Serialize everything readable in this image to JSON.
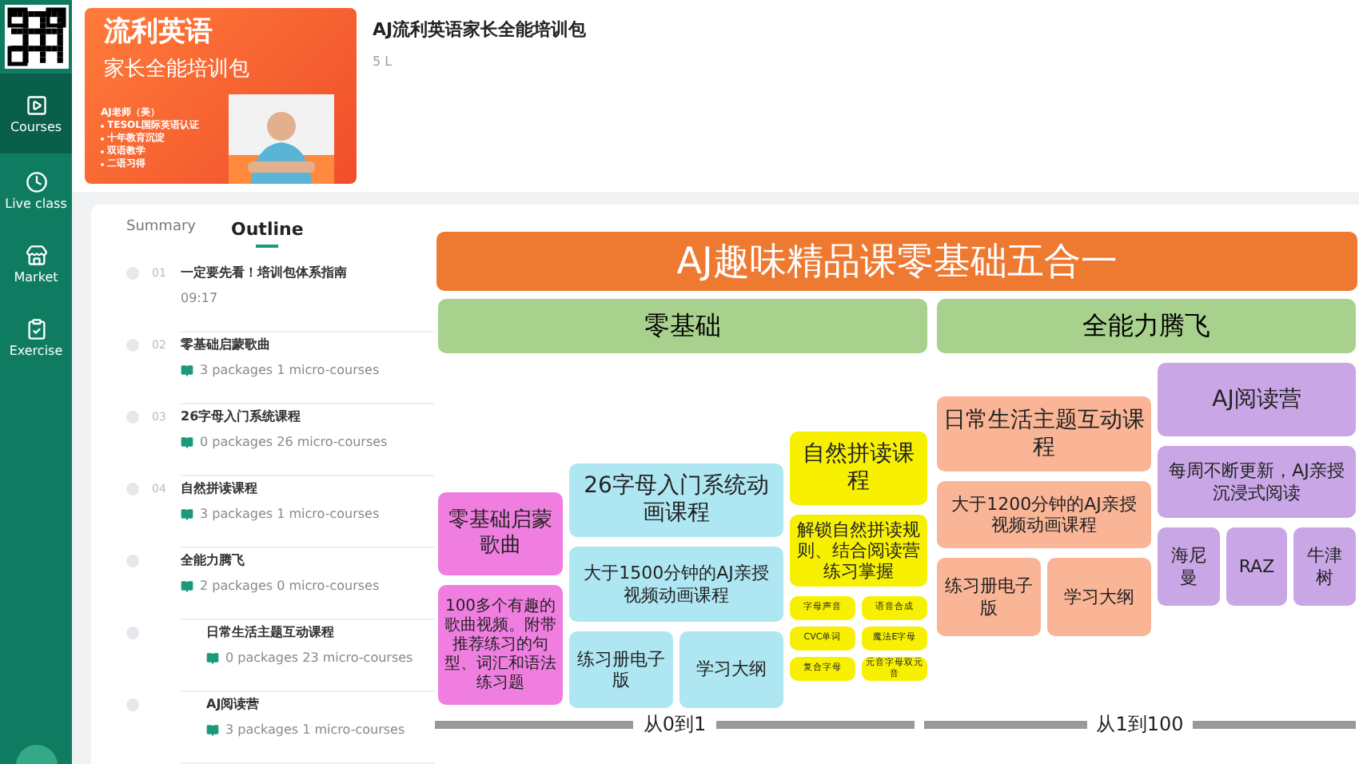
{
  "sidebar": {
    "items": [
      {
        "label": "Courses",
        "kind": "courses",
        "selected": true
      },
      {
        "label": "Live class",
        "kind": "live",
        "selected": false
      },
      {
        "label": "Market",
        "kind": "market",
        "selected": false
      },
      {
        "label": "Exercise",
        "kind": "exercise",
        "selected": false
      }
    ]
  },
  "course": {
    "title": "AJ流利英语家长全能培训包",
    "meta": "5 L",
    "banner": {
      "title": "流利英语",
      "subtitle": "家长全能培训包",
      "teacher": "AJ老师（美）",
      "bullets": [
        "TESOL国际英语认证",
        "十年教育沉淀",
        "双语教学",
        "二语习得"
      ]
    }
  },
  "tabs": [
    {
      "label": "Summary",
      "selected": false
    },
    {
      "label": "Outline",
      "selected": true
    }
  ],
  "outline": [
    {
      "number": "01",
      "title": "一定要先看！培训包体系指南",
      "meta": "09:17"
    },
    {
      "number": "02",
      "title": "零基础启蒙歌曲",
      "meta": "3 packages  1 micro-courses"
    },
    {
      "number": "03",
      "title": "26字母入门系统课程",
      "meta": "0 packages  26 micro-courses"
    },
    {
      "number": "04",
      "title": "自然拼读课程",
      "meta": "3 packages  1 micro-courses"
    },
    {
      "title": "全能力腾飞",
      "meta": "2 packages  0 micro-courses",
      "children": [
        {
          "title": "日常生活主题互动课程",
          "meta": "0 packages  23 micro-courses"
        },
        {
          "title": "AJ阅读营",
          "meta": "3 packages  1 micro-courses"
        }
      ]
    }
  ],
  "diagram": {
    "title": "AJ趣味精品课零基础五合一",
    "sections": [
      "零基础",
      "全能力腾飞"
    ],
    "columns": [
      {
        "color": "#f07ee0",
        "title": "零基础启蒙歌曲",
        "description": "100多个有趣的歌曲视频。附带推荐练习的句型、词汇和语法练习题"
      },
      {
        "color": "#aee6f2",
        "title": "26字母入门系统动画课程",
        "description": "大于1500分钟的AJ亲授视频动画课程",
        "items": [
          "练习册电子版",
          "学习大纲"
        ]
      },
      {
        "color": "#f7f000",
        "title": "自然拼读课程",
        "description": "解锁自然拼读规则、结合阅读营练习掌握",
        "items": [
          "字母声音",
          "语音合成",
          "CVC单词",
          "魔法E字母",
          "复合字母",
          "元音字母双元音"
        ]
      },
      {
        "color": "#f9b596",
        "title": "日常生活主题互动课程",
        "description": "大于1200分钟的AJ亲授视频动画课程",
        "items": [
          "练习册电子版",
          "学习大纲"
        ]
      },
      {
        "color": "#c9a6e6",
        "title": "AJ阅读营",
        "description": "每周不断更新，AJ亲授沉浸式阅读",
        "items": [
          "海尼曼",
          "RAZ",
          "牛津树"
        ]
      }
    ],
    "arrows": [
      "从0到1",
      "从1到100"
    ]
  }
}
